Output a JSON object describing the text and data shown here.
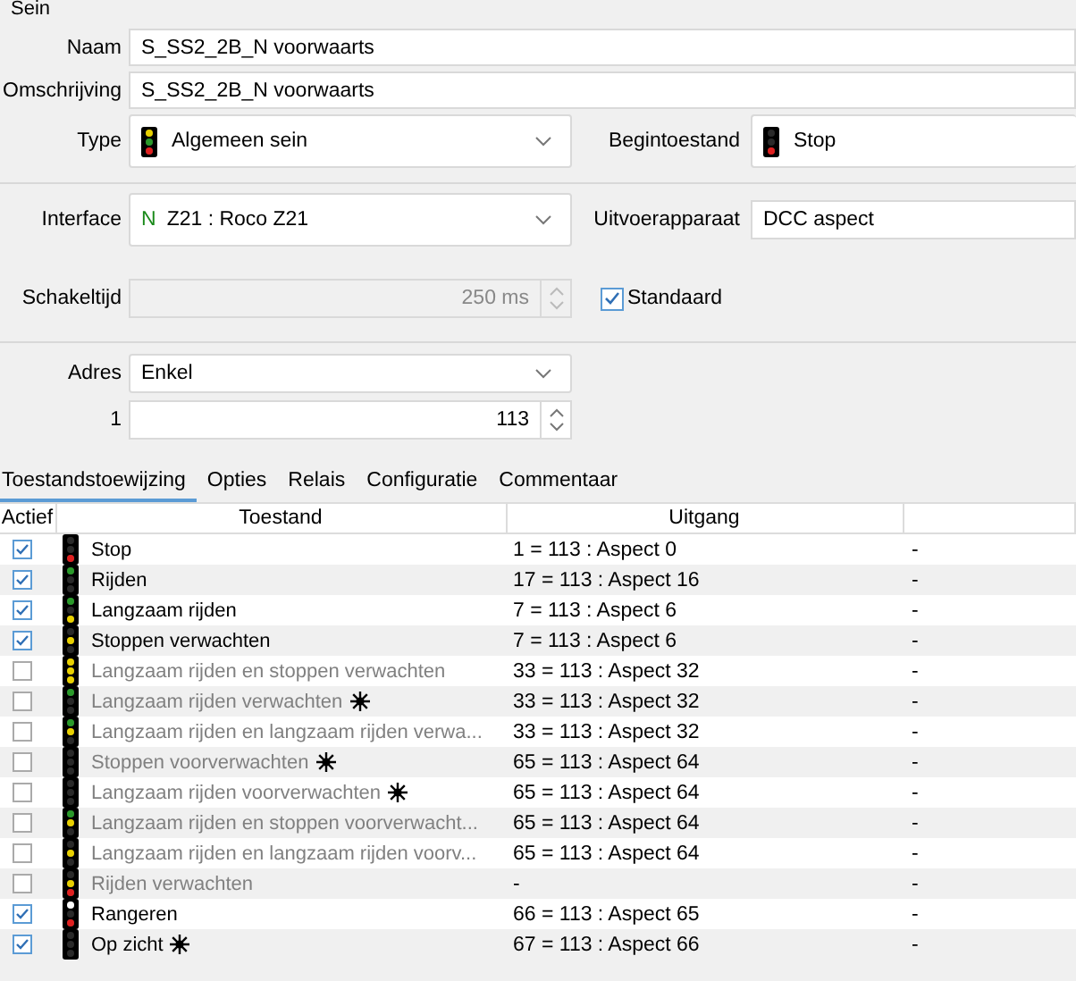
{
  "group_title": "Sein",
  "name_field": {
    "label": "Naam",
    "value": "S_SS2_2B_N voorwaarts"
  },
  "description_field": {
    "label": "Omschrijving",
    "value": "S_SS2_2B_N voorwaarts"
  },
  "type_field": {
    "label": "Type",
    "value": "Algemeen sein",
    "lamps": [
      {
        "kind": "top",
        "color": "#e8d000"
      },
      {
        "kind": "middle",
        "color": "#2a9a2a"
      },
      {
        "kind": "bottom",
        "color": "#e02020"
      }
    ]
  },
  "initial_state_field": {
    "label": "Begintoestand",
    "value": "Stop",
    "lamps": [
      {
        "kind": "bottom",
        "color": "#e02020"
      }
    ]
  },
  "interface_field": {
    "label": "Interface",
    "badge": "N",
    "value": "Z21 : Roco Z21"
  },
  "output_device_field": {
    "label": "Uitvoerapparaat",
    "value": "DCC aspect"
  },
  "switch_time_field": {
    "label": "Schakeltijd",
    "value": "250 ms",
    "disabled": true
  },
  "default_checkbox": {
    "label": "Standaard",
    "checked": true
  },
  "address_field": {
    "label": "Adres",
    "value": "Enkel"
  },
  "address_rows": [
    {
      "label": "1",
      "value": "113"
    }
  ],
  "tabs": [
    {
      "label": "Toestandstoewijzing",
      "selected": true
    },
    {
      "label": "Opties",
      "selected": false
    },
    {
      "label": "Relais",
      "selected": false
    },
    {
      "label": "Configuratie",
      "selected": false
    },
    {
      "label": "Commentaar",
      "selected": false
    }
  ],
  "table": {
    "columns": [
      "Actief",
      "Toestand",
      "Uitgang"
    ],
    "rows": [
      {
        "active": true,
        "state": "Stop",
        "lamps": [
          {
            "kind": "bottom",
            "color": "#e02020"
          }
        ],
        "flashing": false,
        "output": "1 = 113 : Aspect 0",
        "column_4": "-"
      },
      {
        "active": true,
        "state": "Rijden",
        "lamps": [
          {
            "kind": "top",
            "color": "#2a9a2a"
          }
        ],
        "flashing": false,
        "output": "17 = 113 : Aspect 16",
        "column_4": "-"
      },
      {
        "active": true,
        "state": "Langzaam rijden",
        "lamps": [
          {
            "kind": "top",
            "color": "#2a9a2a"
          },
          {
            "kind": "bottom",
            "color": "#e8d000"
          }
        ],
        "flashing": false,
        "output": "7 = 113 : Aspect 6",
        "column_4": "-"
      },
      {
        "active": true,
        "state": "Stoppen verwachten",
        "lamps": [
          {
            "kind": "middle",
            "color": "#e8d000"
          }
        ],
        "flashing": false,
        "output": "7 = 113 : Aspect 6",
        "column_4": "-"
      },
      {
        "active": false,
        "state": "Langzaam rijden en stoppen verwachten",
        "lamps": [
          {
            "kind": "top",
            "color": "#e8d000"
          },
          {
            "kind": "middle",
            "color": "#e8d000"
          },
          {
            "kind": "bottom",
            "color": "#e8d000"
          }
        ],
        "flashing": false,
        "output": "33 = 113 : Aspect 32",
        "column_4": "-"
      },
      {
        "active": false,
        "state": "Langzaam rijden verwachten",
        "lamps": [
          {
            "kind": "top",
            "color": "#2a9a2a"
          }
        ],
        "flashing": true,
        "output": "33 = 113 : Aspect 32",
        "column_4": "-"
      },
      {
        "active": false,
        "state": "Langzaam rijden en langzaam rijden verwa...",
        "lamps": [
          {
            "kind": "top",
            "color": "#2a9a2a"
          },
          {
            "kind": "middle",
            "color": "#e8d000"
          }
        ],
        "flashing": false,
        "output": "33 = 113 : Aspect 32",
        "column_4": "-"
      },
      {
        "active": false,
        "state": "Stoppen voorverwachten",
        "flashing": true,
        "output": "65 = 113 : Aspect 64",
        "column_4": "-"
      },
      {
        "active": false,
        "state": "Langzaam rijden voorverwachten",
        "flashing": true,
        "output": "65 = 113 : Aspect 64",
        "column_4": "-"
      },
      {
        "active": false,
        "state": "Langzaam rijden en stoppen voorverwacht...",
        "lamps": [
          {
            "kind": "top",
            "color": "#2a9a2a"
          },
          {
            "kind": "middle",
            "color": "#e8d000"
          }
        ],
        "flashing": false,
        "output": "65 = 113 : Aspect 64",
        "column_4": "-"
      },
      {
        "active": false,
        "state": "Langzaam rijden en langzaam rijden voorv...",
        "lamps": [
          {
            "kind": "middle",
            "color": "#e8d000"
          }
        ],
        "flashing": false,
        "output": "65 = 113 : Aspect 64",
        "column_4": "-"
      },
      {
        "active": false,
        "state": "Rijden verwachten",
        "lamps": [
          {
            "kind": "middle",
            "color": "#e8d000"
          },
          {
            "kind": "bottom",
            "color": "#e02020"
          }
        ],
        "flashing": false,
        "output": "-",
        "column_4": "-"
      },
      {
        "active": true,
        "state": "Rangeren",
        "lamps": [
          {
            "kind": "top",
            "color": "#ffffff"
          },
          {
            "kind": "bottom",
            "color": "#e02020"
          }
        ],
        "flashing": false,
        "output": "66 = 113 : Aspect 65",
        "column_4": "-"
      },
      {
        "active": true,
        "state": "Op zicht",
        "flashing": true,
        "output": "67 = 113 : Aspect 66",
        "column_4": "-"
      }
    ]
  }
}
